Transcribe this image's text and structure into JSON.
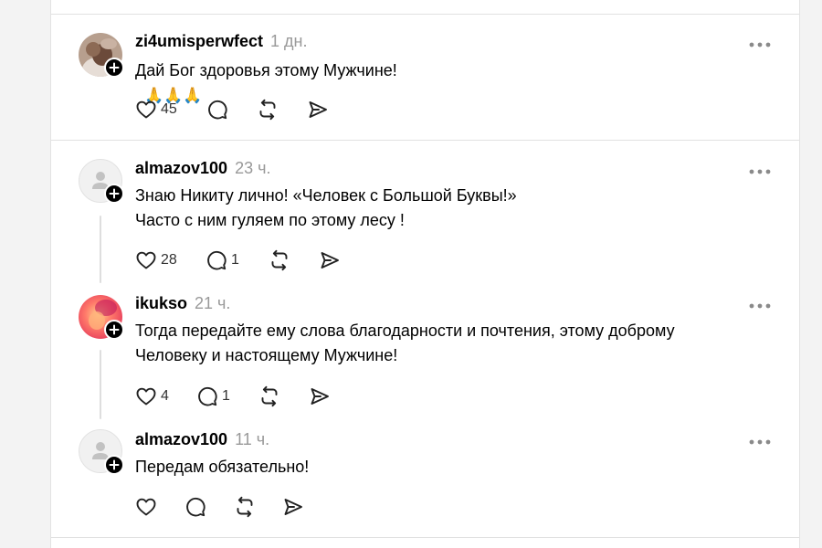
{
  "comments": [
    {
      "username": "zi4umisperwfect",
      "time": "1 дн.",
      "text": "Дай Бог здоровья этому Мужчине!",
      "emoji": "🙏🙏🙏",
      "likes": "45",
      "replies": ""
    },
    {
      "username": "almazov100",
      "time": "23 ч.",
      "lines": [
        "Знаю Никиту лично! «Человек с Большой Буквы!»",
        "Часто с ним гуляем по этому лесу !"
      ],
      "likes": "28",
      "replies": "1"
    },
    {
      "username": "ikukso",
      "time": "21 ч.",
      "lines": [
        "Тогда передайте ему слова благодарности и почтения, этому доброму",
        "Человеку и настоящему Мужчине!"
      ],
      "likes": "4",
      "replies": "1"
    },
    {
      "username": "almazov100",
      "time": "11 ч.",
      "text": "Передам обязательно!",
      "likes": "",
      "replies": ""
    }
  ],
  "icons": {
    "like": "heart-icon",
    "reply": "comment-icon",
    "repost": "repost-icon",
    "share": "send-icon",
    "more": "more-dots-icon",
    "follow": "plus-icon"
  }
}
